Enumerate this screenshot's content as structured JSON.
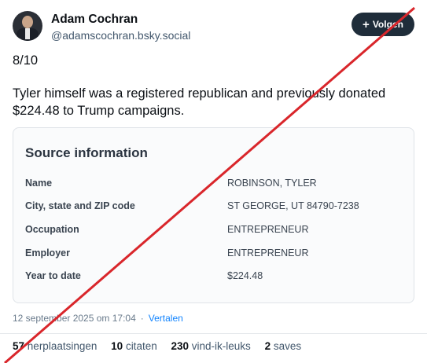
{
  "author": {
    "name": "Adam Cochran",
    "handle": "@adamscochran.bsky.social"
  },
  "follow_button": {
    "icon": "plus-icon",
    "label": "Volgen"
  },
  "post": {
    "line1": "8/10",
    "line2": "Tyler himself was a registered republican and previously donated $224.48 to Trump campaigns."
  },
  "card": {
    "title": "Source information",
    "rows": [
      {
        "label": "Name",
        "value": "ROBINSON, TYLER"
      },
      {
        "label": "City, state and ZIP code",
        "value": "ST GEORGE, UT 84790-7238"
      },
      {
        "label": "Occupation",
        "value": "ENTREPRENEUR"
      },
      {
        "label": "Employer",
        "value": "ENTREPRENEUR"
      },
      {
        "label": "Year to date",
        "value": "$224.48"
      }
    ]
  },
  "meta": {
    "timestamp": "12 september 2025 om 17:04",
    "separator": "·",
    "translate": "Vertalen"
  },
  "stats": {
    "reposts_count": "57",
    "reposts_label": "herplaatsingen",
    "quotes_count": "10",
    "quotes_label": "citaten",
    "likes_count": "230",
    "likes_label": "vind-ik-leuks",
    "saves_count": "2",
    "saves_label": "saves"
  },
  "colors": {
    "slash": "#d9262b",
    "link": "#1083fe",
    "follow_bg": "#1f2d3a"
  }
}
